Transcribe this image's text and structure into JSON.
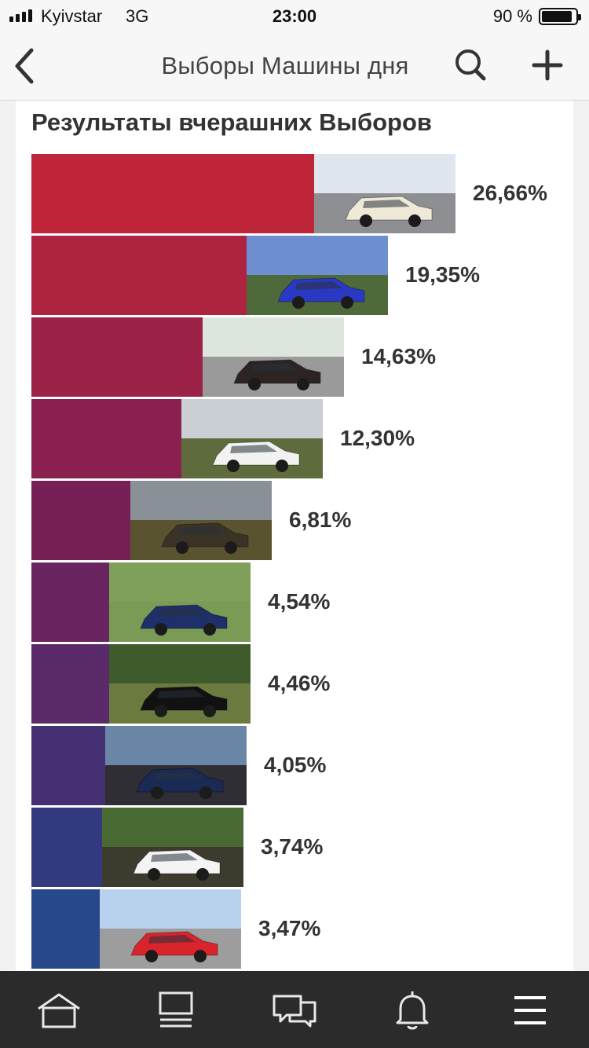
{
  "status": {
    "carrier": "Kyivstar",
    "network": "3G",
    "time": "23:00",
    "battery": "90 %",
    "battery_level": 0.9
  },
  "nav": {
    "title": "Выборы Машины дня"
  },
  "section_title": "Результаты вчерашних Выборов",
  "results": [
    {
      "percent": "26,66%",
      "value": 26.66,
      "color": "#be2538"
    },
    {
      "percent": "19,35%",
      "value": 19.35,
      "color": "#ae2340"
    },
    {
      "percent": "14,63%",
      "value": 14.63,
      "color": "#9c2248"
    },
    {
      "percent": "12,30%",
      "value": 12.3,
      "color": "#8a2050"
    },
    {
      "percent": "6,81%",
      "value": 6.81,
      "color": "#772058"
    },
    {
      "percent": "4,54%",
      "value": 4.54,
      "color": "#6a2560"
    },
    {
      "percent": "4,46%",
      "value": 4.46,
      "color": "#5a2a6a"
    },
    {
      "percent": "4,05%",
      "value": 4.05,
      "color": "#463074"
    },
    {
      "percent": "3,74%",
      "value": 3.74,
      "color": "#343a80"
    },
    {
      "percent": "3,47%",
      "value": 3.47,
      "color": "#28488c"
    }
  ],
  "tabs": [
    {
      "icon": "home-icon"
    },
    {
      "icon": "feed-icon"
    },
    {
      "icon": "messages-icon"
    },
    {
      "icon": "bell-icon"
    },
    {
      "icon": "menu-icon"
    }
  ]
}
